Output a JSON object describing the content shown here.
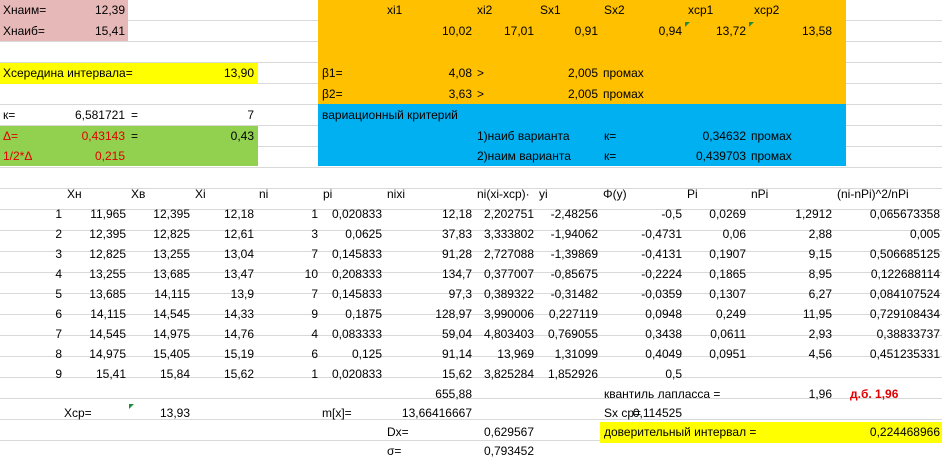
{
  "colors": {
    "pink": "#e6b8b7",
    "yellow": "#ffff00",
    "orange": "#ffc000",
    "green": "#92d050",
    "blue": "#00b0f0",
    "red": "#e00000"
  },
  "top": {
    "xmin_label": "Хнаим=",
    "xmin_value": "12,39",
    "xmax_label": "Хнаиб=",
    "xmax_value": "15,41",
    "mid_label": "Хсередина интервала=",
    "mid_value": "13,90",
    "k_label": "к=",
    "k_value": "6,581721",
    "k_eq": "=",
    "k_round": "7",
    "delta_label": "Δ=",
    "delta_value": "0,43143",
    "delta_eq": "=",
    "delta_round": "0,43",
    "halfdelta_label": "1/2*Δ",
    "halfdelta_value": "0,215"
  },
  "stats": {
    "h_xi1": "xi1",
    "h_xi2": "xi2",
    "h_sx1": "Sx1",
    "h_sx2": "Sx2",
    "h_xcp1": "xcp1",
    "h_xcp2": "xcp2",
    "v_xi1": "10,02",
    "v_xi2": "17,01",
    "v_sx1": "0,91",
    "v_sx2": "0,94",
    "v_xcp1": "13,72",
    "v_xcp2": "13,58",
    "b1_label": "β1=",
    "b1_value": "4,08",
    "b1_gt": ">",
    "b1_crit": "2,005",
    "b1_res": "промах",
    "b2_label": "β2=",
    "b2_value": "3,63",
    "b2_gt": ">",
    "b2_crit": "2,005",
    "b2_res": "промах"
  },
  "variation": {
    "title": "вариационный критерий",
    "r1_label": "1)наиб варианта",
    "r1_k": "к=",
    "r1_value": "0,34632",
    "r1_res": "промах",
    "r2_label": "2)наим варианта",
    "r2_k": "к=",
    "r2_value": "0,439703",
    "r2_res": "промах"
  },
  "table": {
    "headers": [
      "",
      "Хн",
      "Хв",
      "Хi",
      "ni",
      "pi",
      "nixi",
      "ni(xi-xcp)·",
      "yi",
      "Φ(y)",
      "Pi",
      "nPi",
      "(ni-nPi)^2/nPi"
    ],
    "rows": [
      [
        "1",
        "11,965",
        "12,395",
        "12,18",
        "1",
        "0,020833",
        "12,18",
        "2,202751",
        "-2,48256",
        "-0,5",
        "0,0269",
        "1,2912",
        "0,065673358"
      ],
      [
        "2",
        "12,395",
        "12,825",
        "12,61",
        "3",
        "0,0625",
        "37,83",
        "3,333802",
        "-1,94062",
        "-0,4731",
        "0,06",
        "2,88",
        "0,005"
      ],
      [
        "3",
        "12,825",
        "13,255",
        "13,04",
        "7",
        "0,145833",
        "91,28",
        "2,727088",
        "-1,39869",
        "-0,4131",
        "0,1907",
        "9,15",
        "0,506685125"
      ],
      [
        "4",
        "13,255",
        "13,685",
        "13,47",
        "10",
        "0,208333",
        "134,7",
        "0,377007",
        "-0,85675",
        "-0,2224",
        "0,1865",
        "8,95",
        "0,122688114"
      ],
      [
        "5",
        "13,685",
        "14,115",
        "13,9",
        "7",
        "0,145833",
        "97,3",
        "0,389322",
        "-0,31482",
        "-0,0359",
        "0,1307",
        "6,27",
        "0,084107524"
      ],
      [
        "6",
        "14,115",
        "14,545",
        "14,33",
        "9",
        "0,1875",
        "128,97",
        "3,990006",
        "0,227119",
        "0,0948",
        "0,249",
        "11,95",
        "0,729108434"
      ],
      [
        "7",
        "14,545",
        "14,975",
        "14,76",
        "4",
        "0,083333",
        "59,04",
        "4,803403",
        "0,769055",
        "0,3438",
        "0,0611",
        "2,93",
        "0,38833737"
      ],
      [
        "8",
        "14,975",
        "15,405",
        "15,19",
        "6",
        "0,125",
        "91,14",
        "13,969",
        "1,31099",
        "0,4049",
        "0,0951",
        "4,56",
        "0,451235331"
      ],
      [
        "9",
        "15,41",
        "15,84",
        "15,62",
        "1",
        "0,020833",
        "15,62",
        "3,825284",
        "1,852926",
        "0,5",
        "",
        "",
        ""
      ]
    ]
  },
  "bottom": {
    "sum_nixi": "655,88",
    "laplace_label": "квантиль лапласса =",
    "laplace_value": "1,96",
    "laplace_note": "д.б. 1,96",
    "xcp_label": "Хср=",
    "xcp_value": "13,93",
    "mx_label": "m[x]=",
    "mx_value": "13,66416667",
    "sxcp_label": "Sx ср=",
    "sxcp_value": "0,114525",
    "dx_label": "Dx=",
    "dx_value": "0,629567",
    "ci_label": "доверительный интервал =",
    "ci_value": "0,224468966",
    "sigma_label": "σ=",
    "sigma_value": "0,793452"
  }
}
